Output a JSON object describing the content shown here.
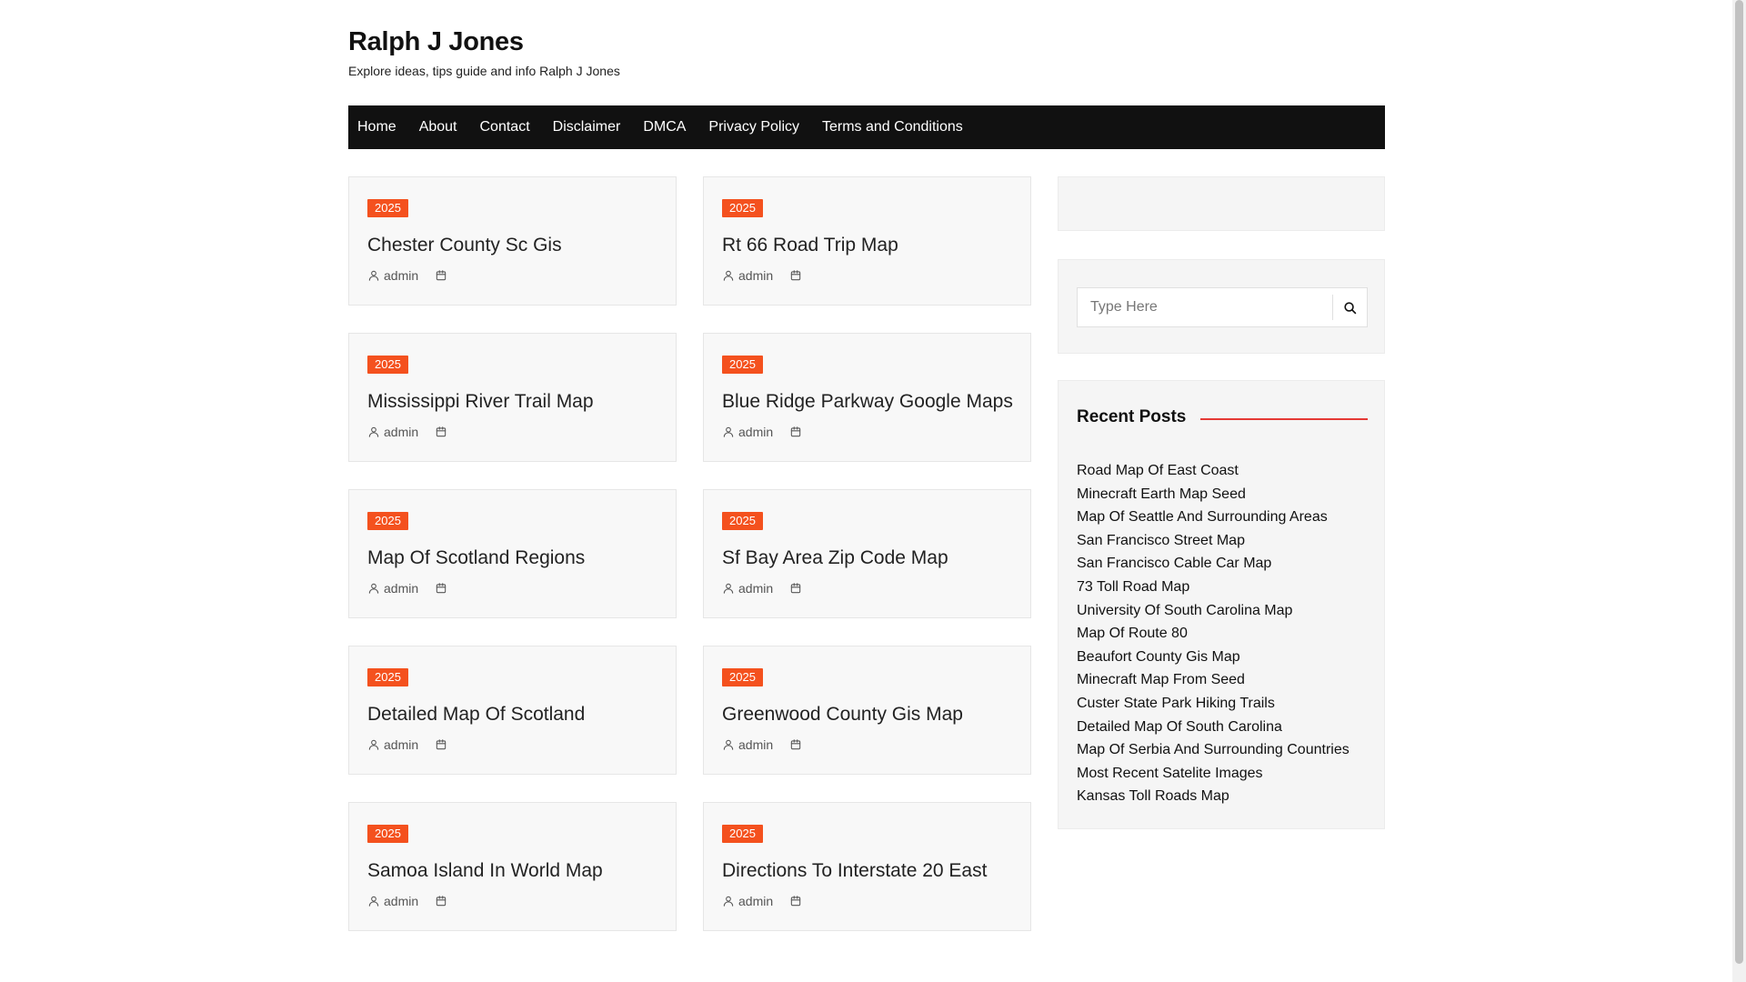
{
  "site": {
    "title": "Ralph J Jones",
    "description": "Explore ideas, tips guide and info Ralph J Jones"
  },
  "nav": {
    "items": [
      "Home",
      "About",
      "Contact",
      "Disclaimer",
      "DMCA",
      "Privacy Policy",
      "Terms and Conditions"
    ]
  },
  "posts": [
    {
      "tag": "2025",
      "title": "Chester County Sc Gis",
      "author": "admin"
    },
    {
      "tag": "2025",
      "title": "Rt 66 Road Trip Map",
      "author": "admin"
    },
    {
      "tag": "2025",
      "title": "Mississippi River Trail Map",
      "author": "admin"
    },
    {
      "tag": "2025",
      "title": "Blue Ridge Parkway Google Maps",
      "author": "admin"
    },
    {
      "tag": "2025",
      "title": "Map Of Scotland Regions",
      "author": "admin"
    },
    {
      "tag": "2025",
      "title": "Sf Bay Area Zip Code Map",
      "author": "admin"
    },
    {
      "tag": "2025",
      "title": "Detailed Map Of Scotland",
      "author": "admin"
    },
    {
      "tag": "2025",
      "title": "Greenwood County Gis Map",
      "author": "admin"
    },
    {
      "tag": "2025",
      "title": "Samoa Island In World Map",
      "author": "admin"
    },
    {
      "tag": "2025",
      "title": "Directions To Interstate 20 East",
      "author": "admin"
    }
  ],
  "search": {
    "placeholder": "Type Here"
  },
  "recent_posts": {
    "heading": "Recent Posts",
    "items": [
      "Road Map Of East Coast",
      "Minecraft Earth Map Seed",
      "Map Of Seattle And Surrounding Areas",
      "San Francisco Street Map",
      "San Francisco Cable Car Map",
      "73 Toll Road Map",
      "University Of South Carolina Map",
      "Map Of Route 80",
      "Beaufort County Gis Map",
      "Minecraft Map From Seed",
      "Custer State Park Hiking Trails",
      "Detailed Map Of South Carolina",
      "Map Of Serbia And Surrounding Countries",
      "Most Recent Satelite Images",
      "Kansas Toll Roads Map"
    ]
  },
  "colors": {
    "tag": "#f4511e",
    "nav_bg": "#111111",
    "accent_line": "#e53935"
  },
  "icons": {
    "author": "user-icon",
    "date": "calendar-icon",
    "search": "search-icon"
  }
}
